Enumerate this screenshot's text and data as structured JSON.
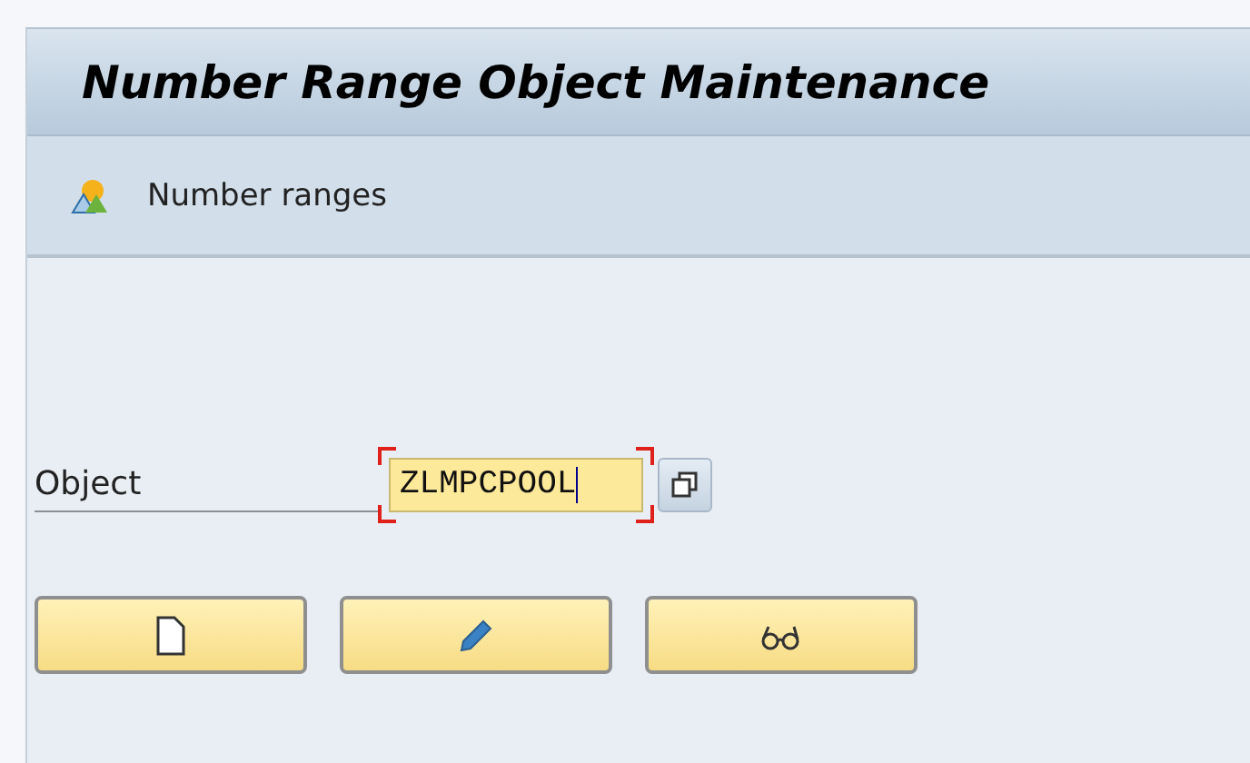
{
  "window": {
    "title": "Number Range Object Maintenance"
  },
  "toolbar": {
    "items": [
      {
        "label": "Number ranges"
      }
    ]
  },
  "object_field": {
    "label": "Object",
    "value": "ZLMPCPOOL",
    "focused": true
  },
  "buttons": [
    {
      "kind": "create"
    },
    {
      "kind": "change"
    },
    {
      "kind": "display"
    }
  ]
}
